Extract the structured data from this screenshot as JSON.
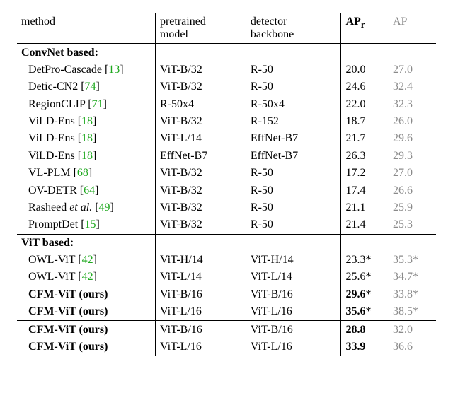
{
  "chart_data": {
    "type": "table",
    "title": "",
    "columns": [
      "method",
      "pretrained model",
      "detector backbone",
      "AP_r",
      "AP"
    ],
    "sections": [
      {
        "name": "ConvNet based:",
        "rows": [
          {
            "method": "DetPro-Cascade",
            "cite": "13",
            "pretrained_model": "ViT-B/32",
            "detector_backbone": "R-50",
            "ap_r": "20.0",
            "ap": "27.0",
            "bold": false,
            "star": false
          },
          {
            "method": "Detic-CN2",
            "cite": "74",
            "pretrained_model": "ViT-B/32",
            "detector_backbone": "R-50",
            "ap_r": "24.6",
            "ap": "32.4",
            "bold": false,
            "star": false
          },
          {
            "method": "RegionCLIP",
            "cite": "71",
            "pretrained_model": "R-50x4",
            "detector_backbone": "R-50x4",
            "ap_r": "22.0",
            "ap": "32.3",
            "bold": false,
            "star": false
          },
          {
            "method": "ViLD-Ens",
            "cite": "18",
            "pretrained_model": "ViT-B/32",
            "detector_backbone": "R-152",
            "ap_r": "18.7",
            "ap": "26.0",
            "bold": false,
            "star": false
          },
          {
            "method": "ViLD-Ens",
            "cite": "18",
            "pretrained_model": "ViT-L/14",
            "detector_backbone": "EffNet-B7",
            "ap_r": "21.7",
            "ap": "29.6",
            "bold": false,
            "star": false
          },
          {
            "method": "ViLD-Ens",
            "cite": "18",
            "pretrained_model": "EffNet-B7",
            "detector_backbone": "EffNet-B7",
            "ap_r": "26.3",
            "ap": "29.3",
            "bold": false,
            "star": false
          },
          {
            "method": "VL-PLM",
            "cite": "68",
            "pretrained_model": "ViT-B/32",
            "detector_backbone": "R-50",
            "ap_r": "17.2",
            "ap": "27.0",
            "bold": false,
            "star": false
          },
          {
            "method": "OV-DETR",
            "cite": "64",
            "pretrained_model": "ViT-B/32",
            "detector_backbone": "R-50",
            "ap_r": "17.4",
            "ap": "26.6",
            "bold": false,
            "star": false
          },
          {
            "method": "Rasheed et al.",
            "cite": "49",
            "pretrained_model": "ViT-B/32",
            "detector_backbone": "R-50",
            "ap_r": "21.1",
            "ap": "25.9",
            "bold": false,
            "star": false,
            "italic_etal": true
          },
          {
            "method": "PromptDet",
            "cite": "15",
            "pretrained_model": "ViT-B/32",
            "detector_backbone": "R-50",
            "ap_r": "21.4",
            "ap": "25.3",
            "bold": false,
            "star": false
          }
        ]
      },
      {
        "name": "ViT based:",
        "rows": [
          {
            "method": "OWL-ViT",
            "cite": "42",
            "pretrained_model": "ViT-H/14",
            "detector_backbone": "ViT-H/14",
            "ap_r": "23.3",
            "ap": "35.3",
            "bold": false,
            "star": true
          },
          {
            "method": "OWL-ViT",
            "cite": "42",
            "pretrained_model": "ViT-L/14",
            "detector_backbone": "ViT-L/14",
            "ap_r": "25.6",
            "ap": "34.7",
            "bold": false,
            "star": true
          },
          {
            "method": "CFM-ViT (ours)",
            "cite": "",
            "pretrained_model": "ViT-B/16",
            "detector_backbone": "ViT-B/16",
            "ap_r": "29.6",
            "ap": "33.8",
            "bold": true,
            "star": true
          },
          {
            "method": "CFM-ViT (ours)",
            "cite": "",
            "pretrained_model": "ViT-L/16",
            "detector_backbone": "ViT-L/16",
            "ap_r": "35.6",
            "ap": "38.5",
            "bold": true,
            "star": true
          },
          {
            "method": "CFM-ViT (ours)",
            "cite": "",
            "pretrained_model": "ViT-B/16",
            "detector_backbone": "ViT-B/16",
            "ap_r": "28.8",
            "ap": "32.0",
            "bold": true,
            "star": false,
            "div_after_prev": true
          },
          {
            "method": "CFM-ViT (ours)",
            "cite": "",
            "pretrained_model": "ViT-L/16",
            "detector_backbone": "ViT-L/16",
            "ap_r": "33.9",
            "ap": "36.6",
            "bold": true,
            "star": false
          }
        ]
      }
    ]
  },
  "header": {
    "method": "method",
    "pretrained_l1": "pretrained",
    "pretrained_l2": "model",
    "backbone_l1": "detector",
    "backbone_l2": "backbone",
    "apr": "AP",
    "apr_sub": "r",
    "ap": "AP"
  },
  "sections": {
    "convnet": "ConvNet based:",
    "vit": "ViT based:"
  },
  "rows": {
    "c0": {
      "m": "DetPro-Cascade ",
      "cite": "13",
      "pm": "ViT-B/32",
      "bk": "R-50",
      "apr": "20.0",
      "ap": "27.0"
    },
    "c1": {
      "m": "Detic-CN2 ",
      "cite": "74",
      "pm": "ViT-B/32",
      "bk": "R-50",
      "apr": "24.6",
      "ap": "32.4"
    },
    "c2": {
      "m": "RegionCLIP ",
      "cite": "71",
      "pm": "R-50x4",
      "bk": "R-50x4",
      "apr": "22.0",
      "ap": "32.3"
    },
    "c3": {
      "m": "ViLD-Ens ",
      "cite": "18",
      "pm": "ViT-B/32",
      "bk": "R-152",
      "apr": "18.7",
      "ap": "26.0"
    },
    "c4": {
      "m": "ViLD-Ens ",
      "cite": "18",
      "pm": "ViT-L/14",
      "bk": "EffNet-B7",
      "apr": "21.7",
      "ap": "29.6"
    },
    "c5": {
      "m": "ViLD-Ens ",
      "cite": "18",
      "pm": "EffNet-B7",
      "bk": "EffNet-B7",
      "apr": "26.3",
      "ap": "29.3"
    },
    "c6": {
      "m": "VL-PLM ",
      "cite": "68",
      "pm": "ViT-B/32",
      "bk": "R-50",
      "apr": "17.2",
      "ap": "27.0"
    },
    "c7": {
      "m": "OV-DETR ",
      "cite": "64",
      "pm": "ViT-B/32",
      "bk": "R-50",
      "apr": "17.4",
      "ap": "26.6"
    },
    "c8": {
      "m1": "Rasheed ",
      "m2": "et al.",
      "m3": " ",
      "cite": "49",
      "pm": "ViT-B/32",
      "bk": "R-50",
      "apr": "21.1",
      "ap": "25.9"
    },
    "c9": {
      "m": "PromptDet ",
      "cite": "15",
      "pm": "ViT-B/32",
      "bk": "R-50",
      "apr": "21.4",
      "ap": "25.3"
    },
    "v0": {
      "m": "OWL-ViT ",
      "cite": "42",
      "pm": "ViT-H/14",
      "bk": "ViT-H/14",
      "apr": "23.3",
      "star": "*",
      "ap": "35.3"
    },
    "v1": {
      "m": "OWL-ViT ",
      "cite": "42",
      "pm": "ViT-L/14",
      "bk": "ViT-L/14",
      "apr": "25.6",
      "star": "*",
      "ap": "34.7"
    },
    "v2": {
      "m": "CFM-ViT (ours)",
      "pm": "ViT-B/16",
      "bk": "ViT-B/16",
      "apr": "29.6",
      "star": "*",
      "ap": "33.8"
    },
    "v3": {
      "m": "CFM-ViT (ours)",
      "pm": "ViT-L/16",
      "bk": "ViT-L/16",
      "apr": "35.6",
      "star": "*",
      "ap": "38.5"
    },
    "v4": {
      "m": "CFM-ViT (ours)",
      "pm": "ViT-B/16",
      "bk": "ViT-B/16",
      "apr": "28.8",
      "ap": "32.0"
    },
    "v5": {
      "m": "CFM-ViT (ours)",
      "pm": "ViT-L/16",
      "bk": "ViT-L/16",
      "apr": "33.9",
      "ap": "36.6"
    }
  }
}
